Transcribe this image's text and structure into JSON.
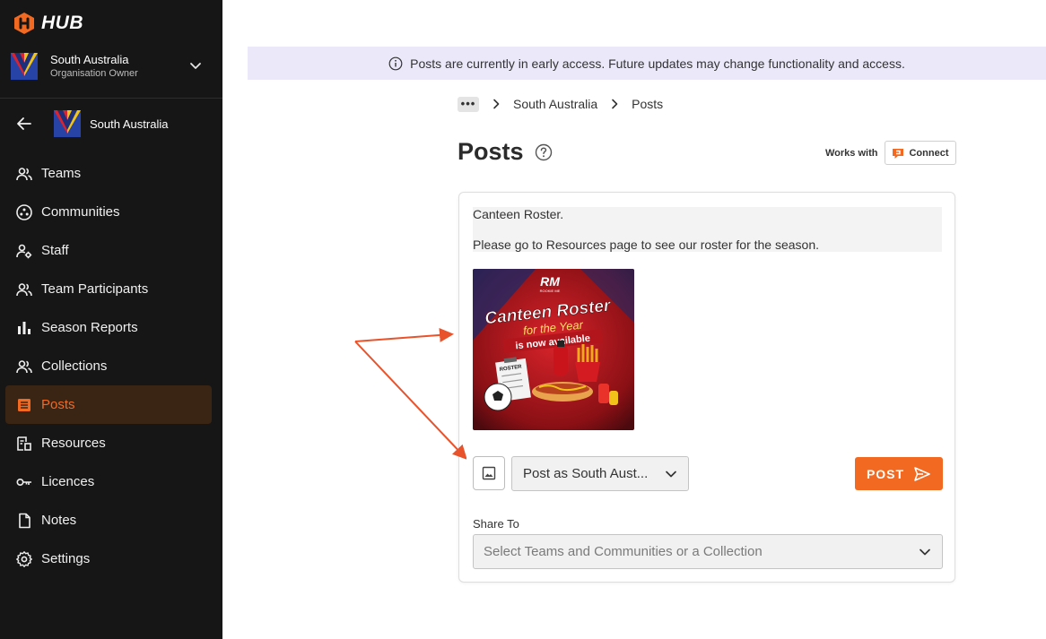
{
  "app": {
    "logo_text": "HUB"
  },
  "org_switcher": {
    "name": "South Australia",
    "role": "Organisation Owner"
  },
  "back_row": {
    "label": "South Australia"
  },
  "sidebar": {
    "items": [
      {
        "label": "Teams",
        "icon": "people-icon"
      },
      {
        "label": "Communities",
        "icon": "communities-icon"
      },
      {
        "label": "Staff",
        "icon": "staff-gear-icon"
      },
      {
        "label": "Team Participants",
        "icon": "people-icon"
      },
      {
        "label": "Season Reports",
        "icon": "bar-chart-icon"
      },
      {
        "label": "Collections",
        "icon": "people-icon"
      },
      {
        "label": "Posts",
        "icon": "posts-icon",
        "active": true
      },
      {
        "label": "Resources",
        "icon": "resources-icon"
      },
      {
        "label": "Licences",
        "icon": "key-icon"
      },
      {
        "label": "Notes",
        "icon": "note-icon"
      },
      {
        "label": "Settings",
        "icon": "gear-icon"
      }
    ]
  },
  "banner": {
    "text": "Posts are currently in early access. Future updates may change functionality and access."
  },
  "breadcrumb": {
    "more": "•••",
    "org": "South Australia",
    "current": "Posts"
  },
  "page": {
    "title": "Posts"
  },
  "works_with": {
    "label": "Works with",
    "product": "Connect"
  },
  "composer": {
    "line1": "Canteen Roster.",
    "line2": "Please go to Resources page to see our roster for the season.",
    "post_as": "Post as South Aust...",
    "post_button": "POST",
    "share_label": "Share To",
    "share_placeholder": "Select Teams and Communities or a Collection"
  },
  "post_image": {
    "brand": "RM",
    "brand_sub": "ROOKIE ME",
    "headline": "Canteen Roster",
    "subline": "for the Year",
    "ribbon": "is now available",
    "clipboard_label": "ROSTER"
  },
  "colors": {
    "accent": "#f26a22",
    "sidebar_bg": "#161616",
    "banner_bg": "#ebe8fa",
    "annotation": "#e8532b"
  }
}
